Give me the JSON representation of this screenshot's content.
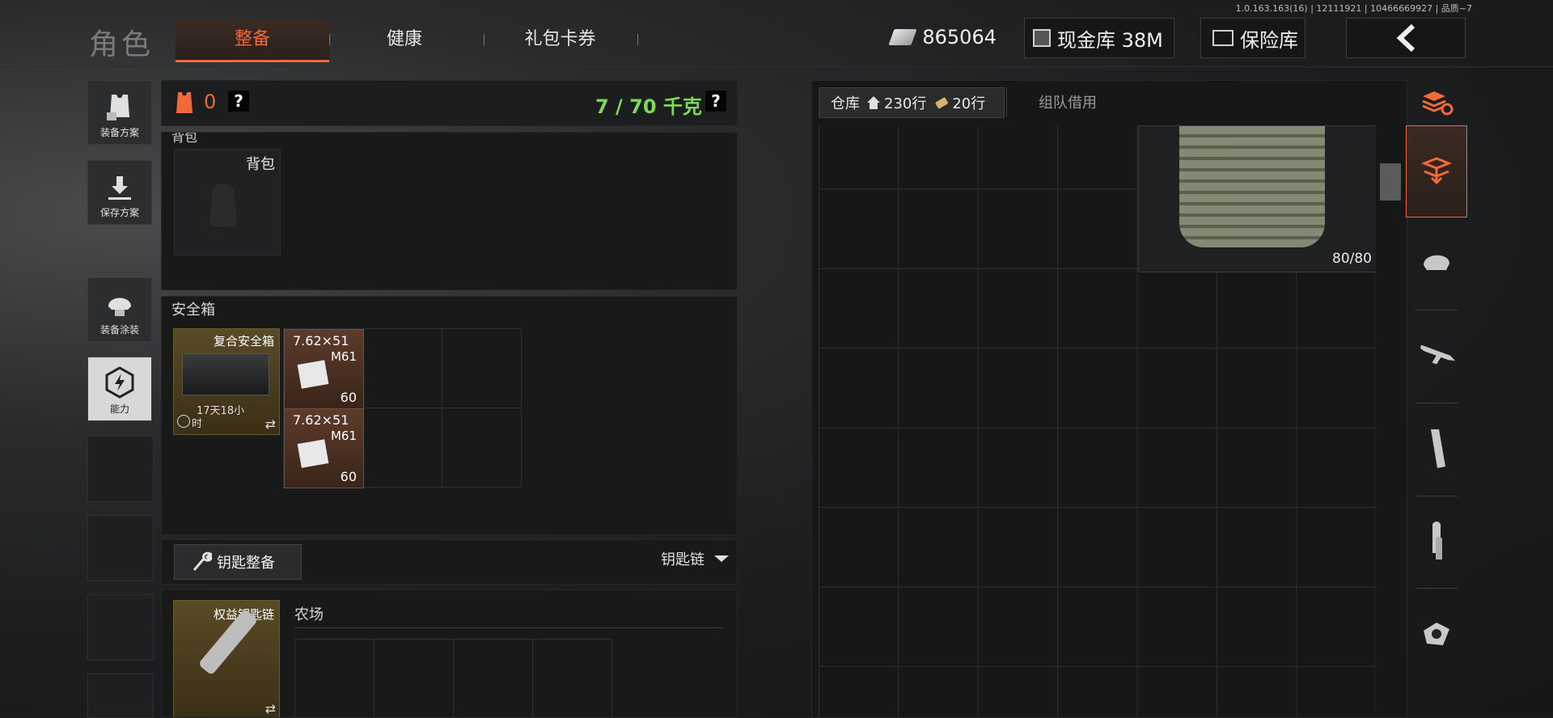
{
  "build_info": "1.0.163.163(16) | 12111921 | 10466669927 | 品质~7",
  "header": {
    "title": "角色",
    "tabs": [
      {
        "label": "整备",
        "active": true
      },
      {
        "label": "健康",
        "active": false
      },
      {
        "label": "礼包卡券",
        "active": false
      }
    ],
    "currency": {
      "icon": "cash-icon",
      "value": "865064"
    },
    "cash_vault": {
      "icon": "vault-card-icon",
      "label": "现金库 38M"
    },
    "safe_vault": {
      "icon": "safe-icon",
      "label": "保险库"
    },
    "back_icon": "chevron-left-icon"
  },
  "left_menu": {
    "items": [
      {
        "label": "装备方案",
        "icon": "vest-preset-icon"
      },
      {
        "label": "保存方案",
        "icon": "download-icon"
      },
      {
        "label": "装备涂装",
        "icon": "helmet-paint-icon"
      },
      {
        "label": "能力",
        "icon": "ability-icon"
      }
    ]
  },
  "loadout": {
    "armor_count": "0",
    "help": "?",
    "weight": "7 / 70 千克",
    "weight_color": "#7ed957",
    "backpack_section_label": "背包",
    "backpack_slot_label": "背包",
    "safe_box_title": "安全箱",
    "safe_box": {
      "name": "复合安全箱",
      "timer_line1": "17天18小",
      "timer_line2": "时",
      "swap": "⇄"
    },
    "safe_items": [
      {
        "caliber": "7.62×51",
        "type": "M61",
        "count": "60"
      },
      {
        "caliber": "7.62×51",
        "type": "M61",
        "count": "60"
      }
    ],
    "key_button": "钥匙整备",
    "key_dropdown": "钥匙链",
    "keychain": {
      "name": "权益钥匙链",
      "location": "农场",
      "swap": "⇄"
    }
  },
  "warehouse": {
    "tab_label": "仓库",
    "rows_home": "230行",
    "rows_ticket": "20行",
    "team_tab": "组队借用",
    "item_durability": "80/80"
  },
  "side_nav": {
    "icons": [
      "stack-refresh-icon",
      "stack-download-icon",
      "helmet-icon",
      "rifle-icon",
      "magazine-icon",
      "ammo-icon",
      "sight-icon"
    ]
  },
  "colors": {
    "accent": "#f0693a",
    "weight_green": "#7ed957"
  }
}
